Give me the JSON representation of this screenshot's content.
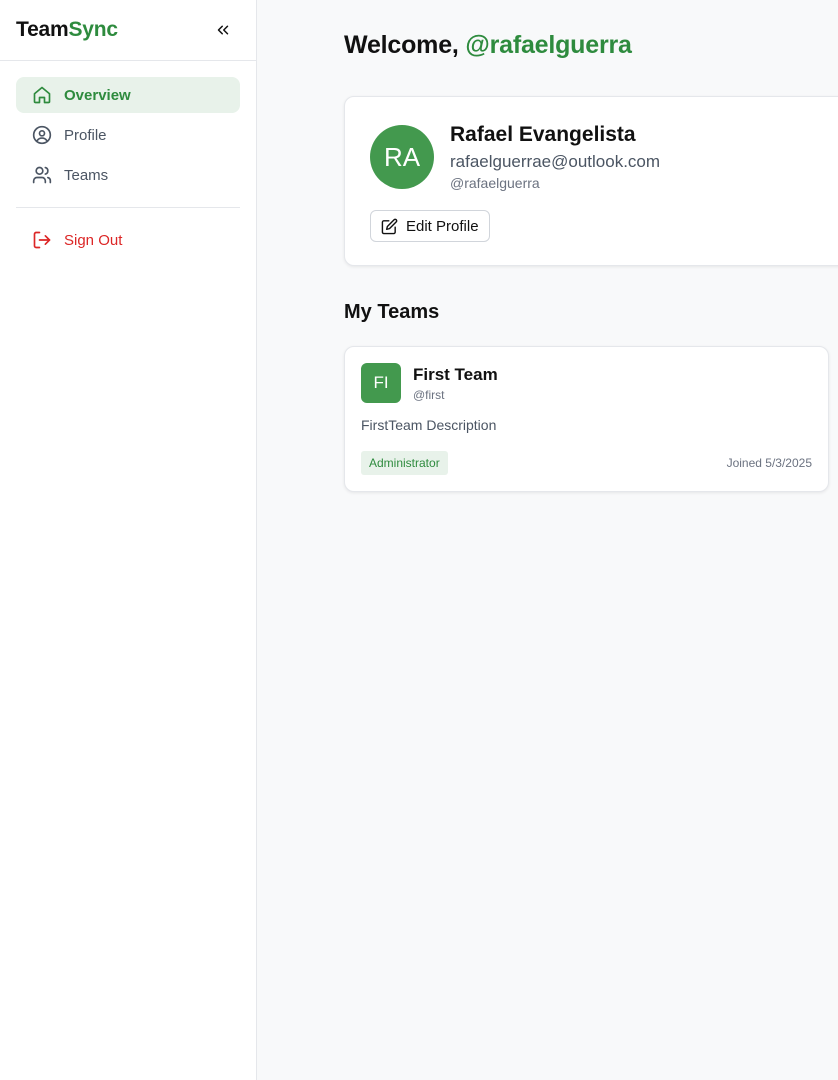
{
  "brand": {
    "part1": "Team",
    "part2": "Sync"
  },
  "sidebar": {
    "items": [
      {
        "label": "Overview",
        "icon": "home-icon",
        "active": true
      },
      {
        "label": "Profile",
        "icon": "user-circle-icon",
        "active": false
      },
      {
        "label": "Teams",
        "icon": "users-icon",
        "active": false
      }
    ],
    "signout": {
      "label": "Sign Out",
      "icon": "logout-icon"
    }
  },
  "welcome": {
    "prefix": "Welcome, ",
    "handle": "@rafaelguerra"
  },
  "profile": {
    "initials": "RA",
    "name": "Rafael Evangelista",
    "email": "rafaelguerrae@outlook.com",
    "username": "@rafaelguerra",
    "edit_label": "Edit Profile"
  },
  "teams_section": {
    "title": "My Teams",
    "teams": [
      {
        "initials": "FI",
        "name": "First Team",
        "handle": "@first",
        "description": "FirstTeam Description",
        "role": "Administrator",
        "joined": "Joined 5/3/2025"
      }
    ]
  },
  "colors": {
    "accent": "#2e8b3e",
    "avatar_bg": "#43994e",
    "active_bg": "#e8f2ea",
    "danger": "#dc2626"
  }
}
